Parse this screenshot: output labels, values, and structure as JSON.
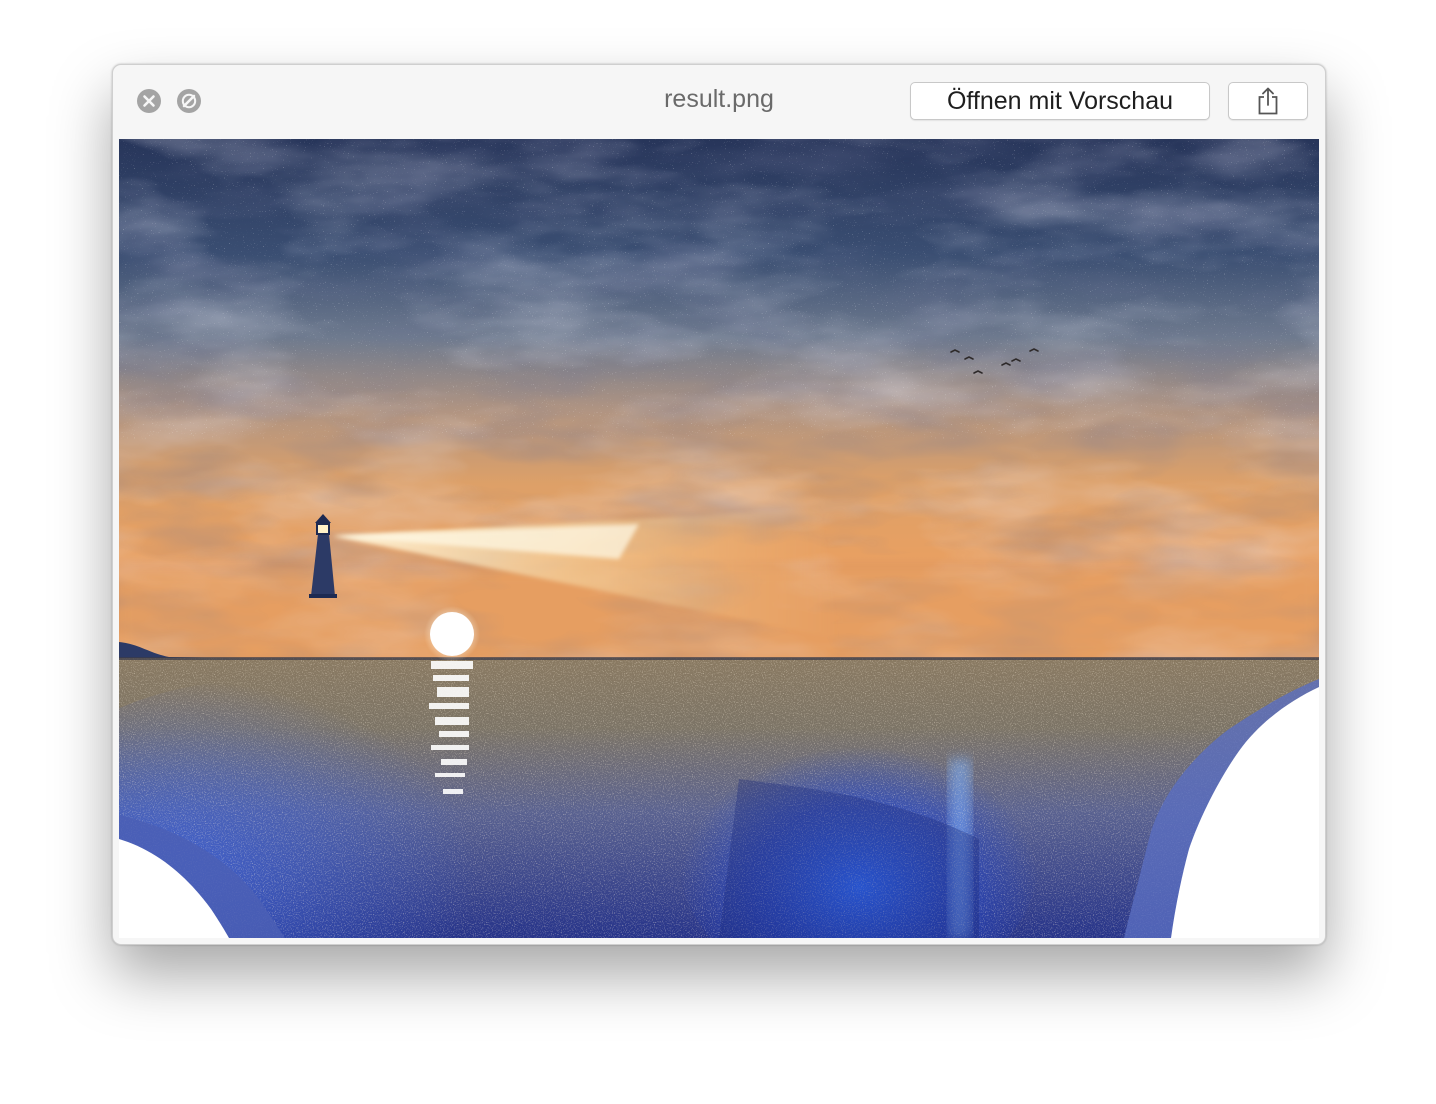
{
  "window": {
    "title": "result.png"
  },
  "toolbar": {
    "open_with_label": "Öffnen mit Vorschau",
    "share_icon": "share-icon",
    "close_icon": "close-icon",
    "fullscreen_icon": "fullscreen-icon"
  },
  "preview": {
    "description_icon": "rendered-image",
    "colors": {
      "sky_top": "#2c3a5c",
      "horizon_glow": "#e8a062",
      "sea": "#3552b8",
      "shore": "#ffffff"
    }
  }
}
